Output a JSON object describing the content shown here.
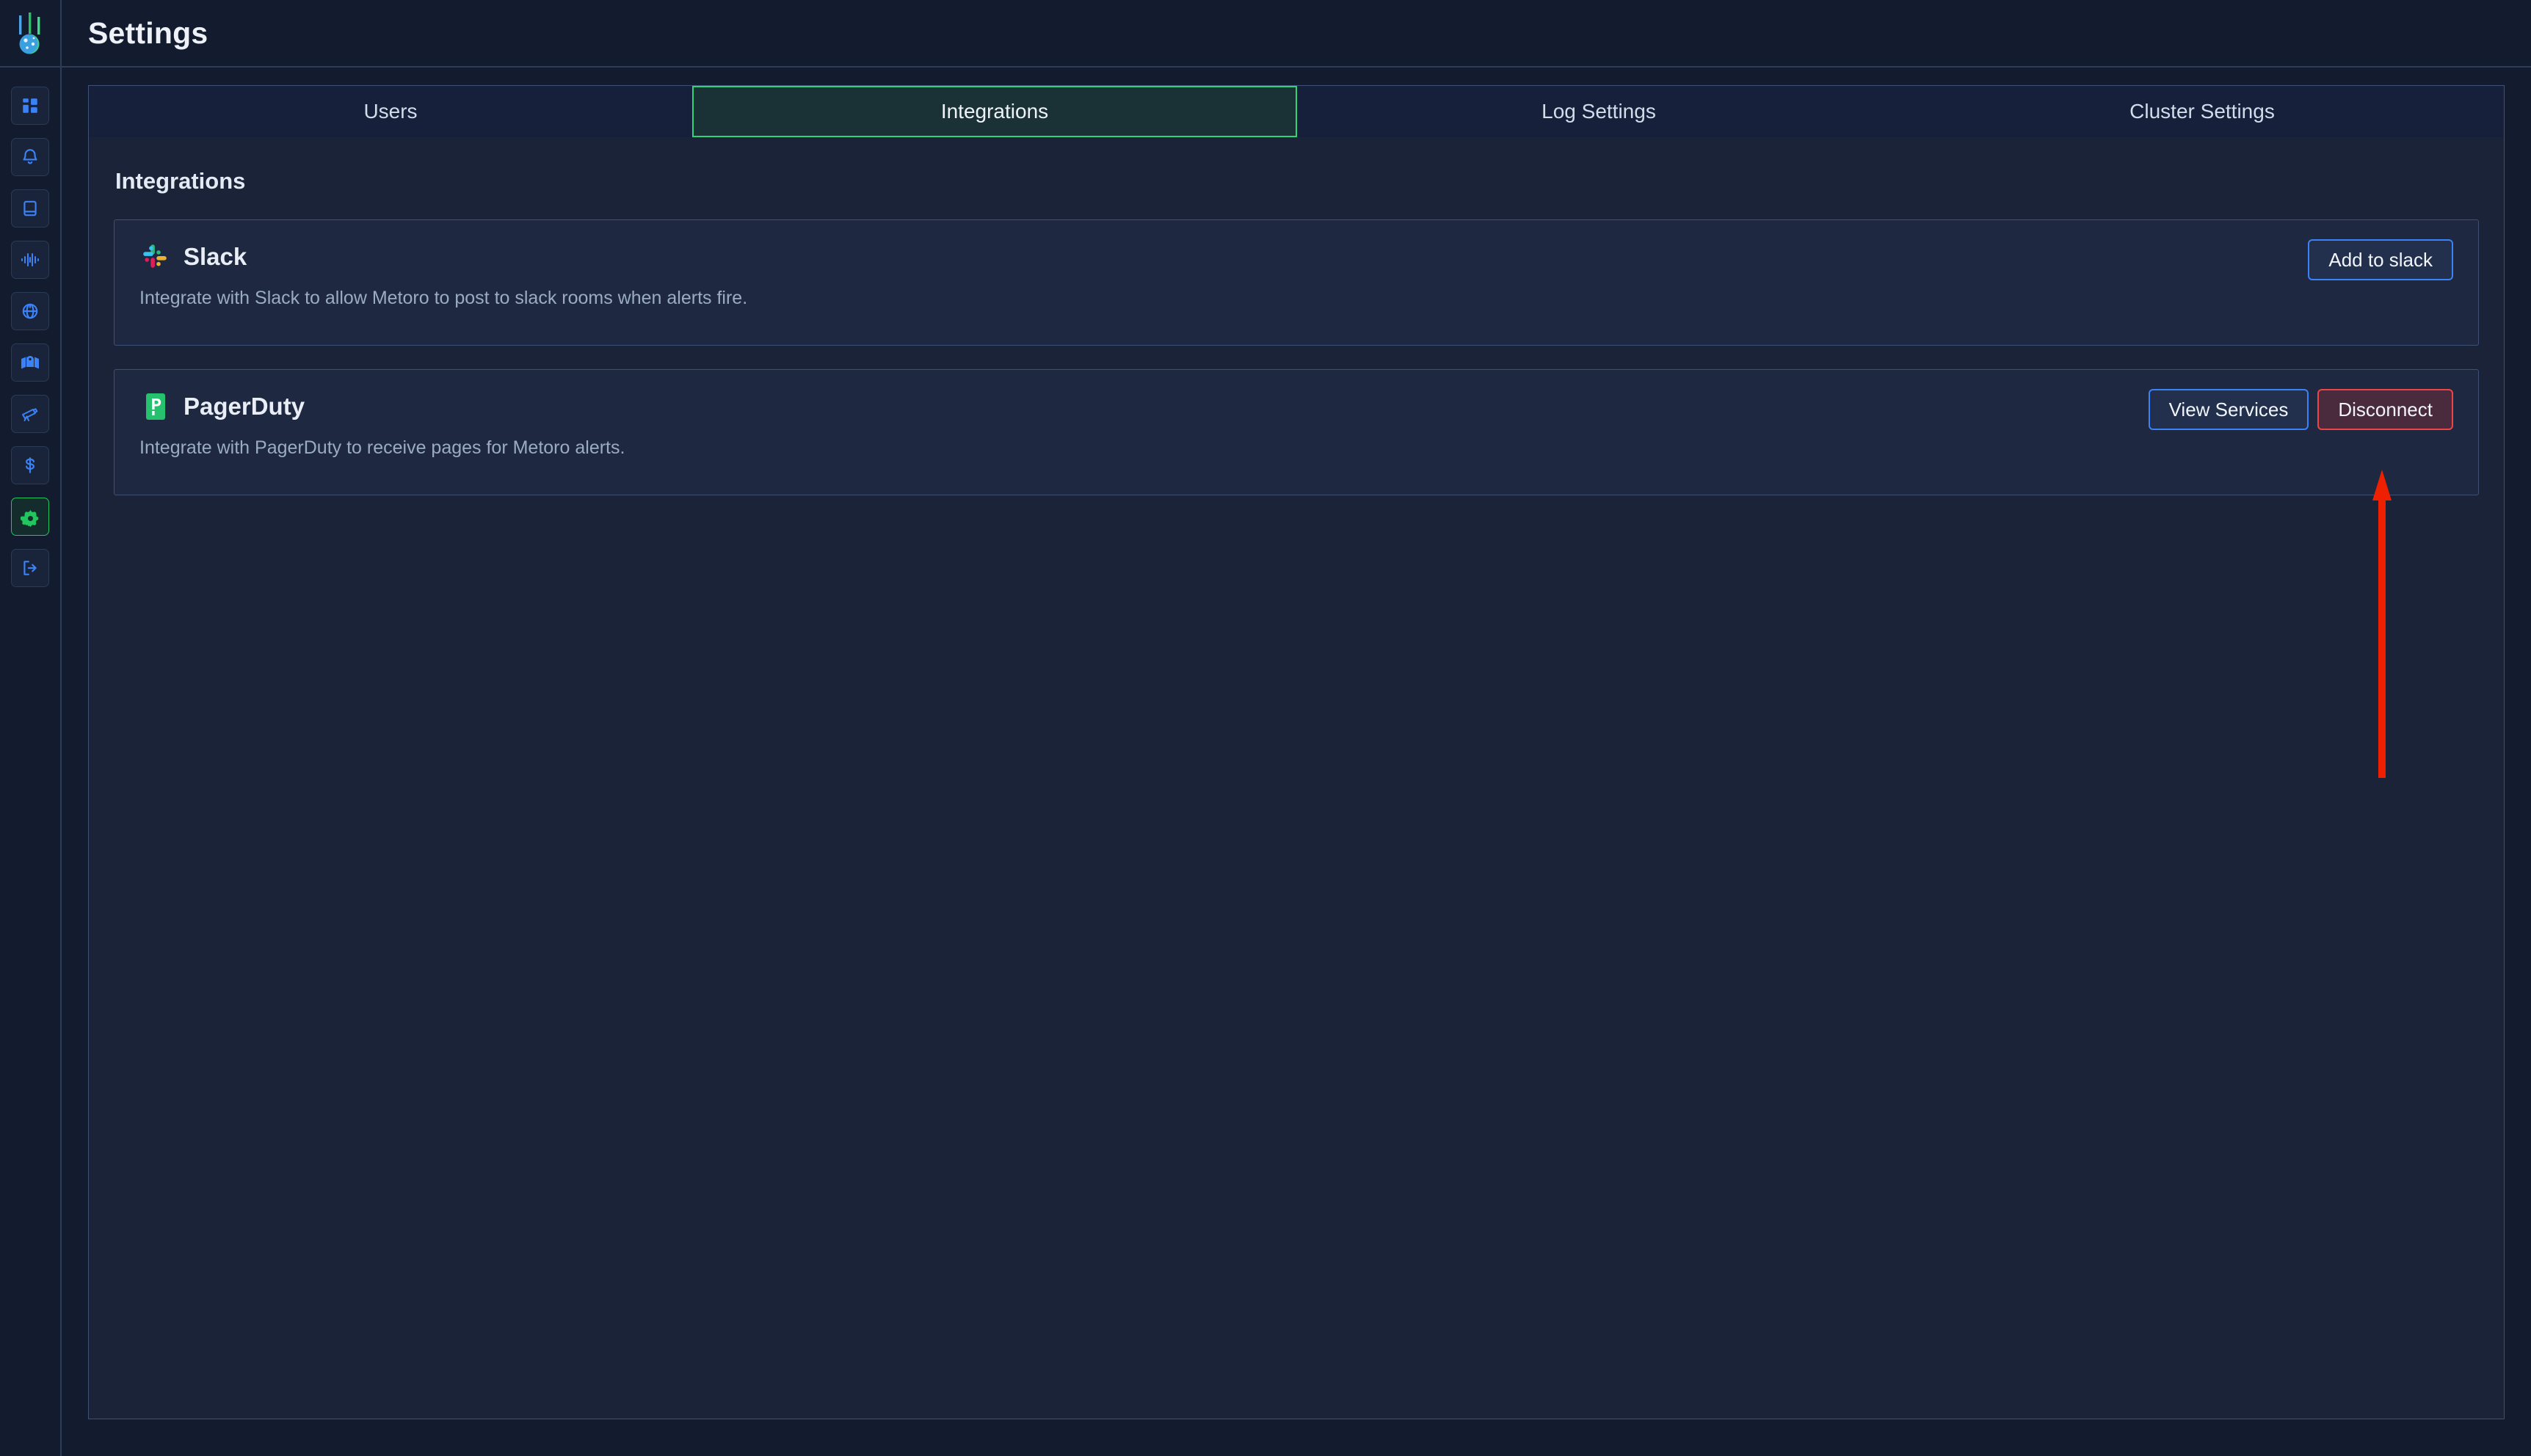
{
  "app": {
    "logo_icon": "metoro-meteor-logo",
    "page_title": "Settings"
  },
  "sidebar": {
    "items": [
      {
        "icon": "dashboard-grid-icon",
        "name": "dashboard",
        "active": false
      },
      {
        "icon": "bell-icon",
        "name": "alerts",
        "active": false
      },
      {
        "icon": "logs-book-icon",
        "name": "logs",
        "active": false
      },
      {
        "icon": "metrics-waveform-icon",
        "name": "metrics",
        "active": false
      },
      {
        "icon": "globe-icon",
        "name": "traces",
        "active": false
      },
      {
        "icon": "map-icon",
        "name": "service-map",
        "active": false
      },
      {
        "icon": "telescope-icon",
        "name": "explore",
        "active": false
      },
      {
        "icon": "dollar-icon",
        "name": "cost",
        "active": false
      },
      {
        "icon": "gear-icon",
        "name": "settings",
        "active": true
      },
      {
        "icon": "logout-icon",
        "name": "logout",
        "active": false
      }
    ]
  },
  "tabs": [
    {
      "label": "Users",
      "active": false
    },
    {
      "label": "Integrations",
      "active": true
    },
    {
      "label": "Log Settings",
      "active": false
    },
    {
      "label": "Cluster Settings",
      "active": false
    }
  ],
  "main": {
    "section_title": "Integrations",
    "integrations": [
      {
        "name": "Slack",
        "logo_icon": "slack-logo-icon",
        "description": "Integrate with Slack to allow Metoro to post to slack rooms when alerts fire.",
        "actions": [
          {
            "label": "Add to slack",
            "style": "primary",
            "name": "add-to-slack-button"
          }
        ]
      },
      {
        "name": "PagerDuty",
        "logo_icon": "pagerduty-logo-icon",
        "description": "Integrate with PagerDuty to receive pages for Metoro alerts.",
        "actions": [
          {
            "label": "View Services",
            "style": "primary",
            "name": "view-services-button"
          },
          {
            "label": "Disconnect",
            "style": "danger",
            "name": "disconnect-button"
          }
        ]
      }
    ]
  },
  "annotation": {
    "arrow_color": "#ef2000",
    "points_to": "disconnect-button"
  },
  "colors": {
    "accent_blue": "#3b82f6",
    "accent_green": "#22c55e",
    "danger_red": "#ef4444",
    "page_bg": "#131c2e",
    "panel_bg": "#1a2337",
    "card_bg": "#1e2840",
    "border": "#3e5073"
  }
}
